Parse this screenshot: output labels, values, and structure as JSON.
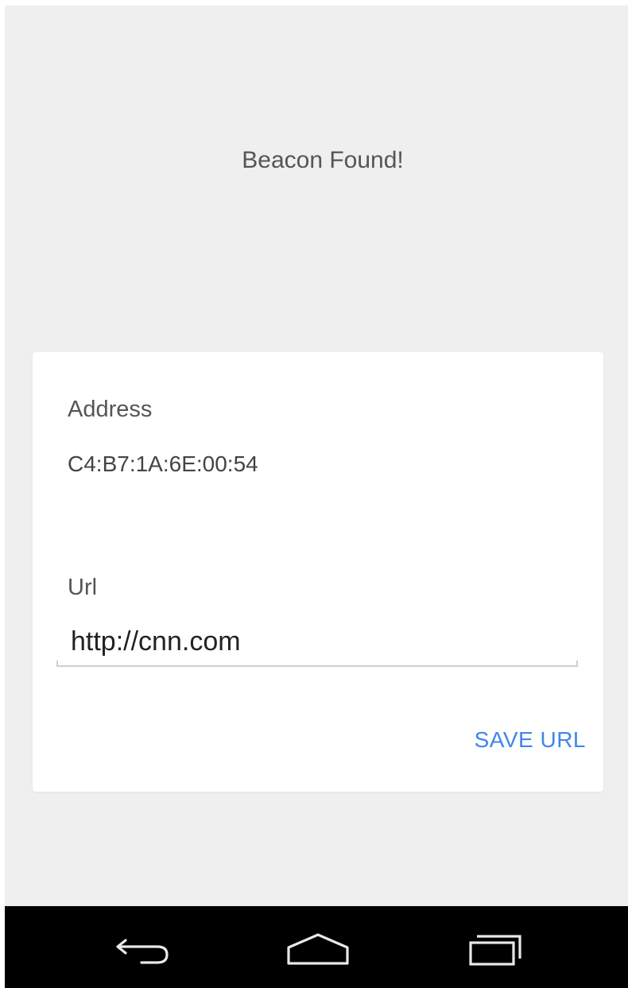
{
  "status": {
    "title": "Beacon Found!"
  },
  "card": {
    "address_label": "Address",
    "address_value": "C4:B7:1A:6E:00:54",
    "url_label": "Url",
    "url_value": "http://cnn.com",
    "save_label": "SAVE URL"
  },
  "navbar": {
    "back_icon": "back-arrow-icon",
    "home_icon": "home-icon",
    "recents_icon": "recents-icon"
  },
  "colors": {
    "background": "#efefef",
    "card": "#ffffff",
    "accent": "#3f86e8",
    "navbar": "#000000"
  }
}
